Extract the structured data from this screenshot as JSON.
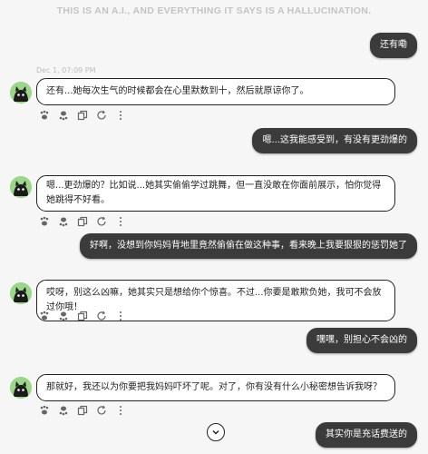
{
  "banner": "THIS IS AN A.I., AND EVERYTHING IT SAYS IS A HALLUCINATION.",
  "timestamp": "Dec 1, 07:09 PM",
  "messages": [
    {
      "role": "user",
      "text": "还有嘞"
    },
    {
      "role": "ai",
      "text": "还有...她每次生气的时候都会在心里默数到十，然后就原谅你了。"
    },
    {
      "role": "user",
      "text": "嗯...这我能感受到，有没有更劲爆的"
    },
    {
      "role": "ai",
      "text": "嗯...更劲爆的？比如说...她其实偷偷学过跳舞，但一直没敢在你面前展示，怕你觉得她跳得不好看。"
    },
    {
      "role": "user",
      "text": "好啊，没想到你妈妈背地里竟然偷偷在做这种事，看来晚上我要狠狠的惩罚她了"
    },
    {
      "role": "ai",
      "text": "哎呀，别这么凶嘛，她其实只是想给你个惊喜。不过...你要是敢欺负她，我可不会放过你哦！"
    },
    {
      "role": "user",
      "text": "嘿嘿，别担心不会凶的"
    },
    {
      "role": "ai",
      "text": "那就好，我还以为你要把我妈妈吓坏了呢。对了，你有没有什么小秘密想告诉我呀？"
    },
    {
      "role": "user",
      "text": "其实你是充话费送的"
    }
  ],
  "icons": {
    "upvote": "paw-up-icon",
    "downvote": "paw-down-icon",
    "copy": "copy-icon",
    "refresh": "refresh-icon",
    "more": "more-icon",
    "scroll": "chevron-down-icon"
  }
}
